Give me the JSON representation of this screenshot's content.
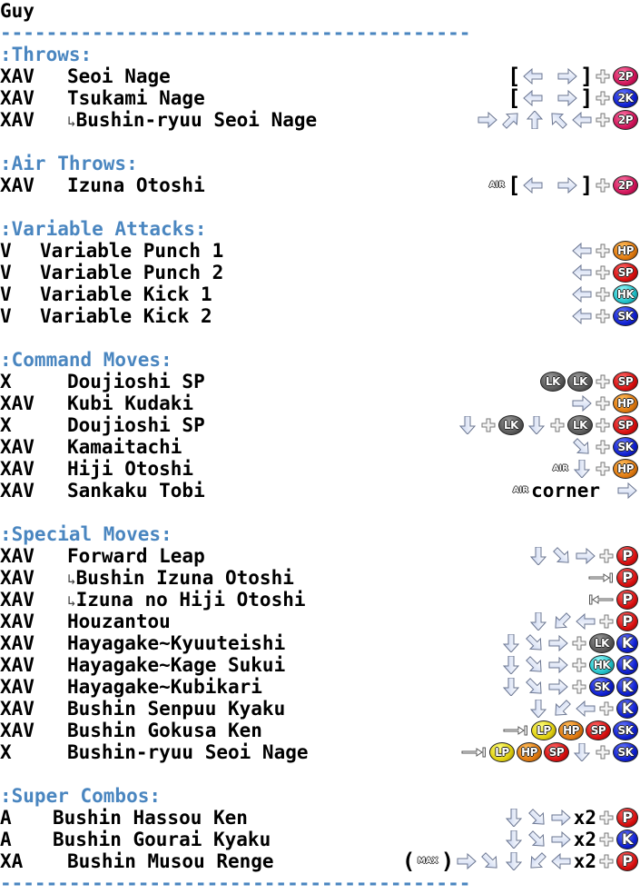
{
  "character": "Guy",
  "separator": "-----------------------------------------",
  "sections": {
    "throws": {
      "title": ":Throws:",
      "moves": [
        {
          "versions": "XAV",
          "name": "Seoi Nage",
          "input": "[ back/forward ] + 2P"
        },
        {
          "versions": "XAV",
          "name": "Tsukami Nage",
          "input": "[ back/forward ] + 2K"
        },
        {
          "versions": "XAV",
          "name": "Bushin-ryuu Seoi Nage",
          "hook": "↳",
          "input": "forward, up-forward, up, up-back, back + 2P"
        }
      ]
    },
    "air_throws": {
      "title": ":Air Throws:",
      "moves": [
        {
          "versions": "XAV",
          "name": "Izuna Otoshi",
          "input": "AIR [ back/forward ] + 2P"
        }
      ]
    },
    "variable": {
      "title": ":Variable Attacks:",
      "moves": [
        {
          "versions": "V",
          "name": "Variable Punch 1",
          "input": "back + HP"
        },
        {
          "versions": "V",
          "name": "Variable Punch 2",
          "input": "back + SP"
        },
        {
          "versions": "V",
          "name": "Variable Kick 1",
          "input": "back + HK"
        },
        {
          "versions": "V",
          "name": "Variable Kick 2",
          "input": "back + SK"
        }
      ]
    },
    "command": {
      "title": ":Command Moves:",
      "moves": [
        {
          "versions": "X",
          "name": "Doujioshi SP",
          "input": "LK LK + SP"
        },
        {
          "versions": "XAV",
          "name": "Kubi Kudaki",
          "input": "forward + HP"
        },
        {
          "versions": "X",
          "name": "Doujioshi SP",
          "input": "down + LK down + LK + SP"
        },
        {
          "versions": "XAV",
          "name": "Kamaitachi",
          "input": "down-forward + SK"
        },
        {
          "versions": "XAV",
          "name": "Hiji Otoshi",
          "input": "AIR down + HP"
        },
        {
          "versions": "XAV",
          "name": "Sankaku Tobi",
          "input": "AIR corner forward",
          "corner_text": "corner"
        }
      ]
    },
    "special": {
      "title": ":Special Moves:",
      "moves": [
        {
          "versions": "XAV",
          "name": "Forward Leap",
          "input": "down, down-forward, forward + P"
        },
        {
          "versions": "XAV",
          "name": "Bushin Izuna Otoshi",
          "hook": "↳",
          "input": "slide-forward P"
        },
        {
          "versions": "XAV",
          "name": "Izuna no Hiji Otoshi",
          "hook": "↳",
          "input": "slide-back P"
        },
        {
          "versions": "XAV",
          "name": "Houzantou",
          "input": "down, down-back, back + P"
        },
        {
          "versions": "XAV",
          "name": "Hayagake~Kyuuteishi",
          "input": "down, down-forward, forward + LK K"
        },
        {
          "versions": "XAV",
          "name": "Hayagake~Kage Sukui",
          "input": "down, down-forward, forward + HK K"
        },
        {
          "versions": "XAV",
          "name": "Hayagake~Kubikari",
          "input": "down, down-forward, forward + SK K"
        },
        {
          "versions": "XAV",
          "name": "Bushin Senpuu Kyaku",
          "input": "down, down-back, back + K"
        },
        {
          "versions": "XAV",
          "name": "Bushin Gokusa Ken",
          "input": "slide LP HP SP SK"
        },
        {
          "versions": "X",
          "name": "Bushin-ryuu Seoi Nage",
          "input": "slide LP HP SP down + SK"
        }
      ]
    },
    "super": {
      "title": ":Super Combos:",
      "moves": [
        {
          "versions": "A",
          "name": "Bushin Hassou Ken",
          "input": "down, down-forward, forward x2 + P"
        },
        {
          "versions": "A",
          "name": "Bushin Gourai Kyaku",
          "input": "down, down-forward, forward x2 + K"
        },
        {
          "versions": "XA",
          "name": "Bushin Musou Renge",
          "input": "(MAX) forward, down-forward, down, down-back, back x2 + P"
        }
      ]
    }
  },
  "labels": {
    "air": "AIR",
    "max": "MAX",
    "x2": "x2",
    "corner": "corner",
    "open_bracket": "[",
    "close_bracket": "]",
    "open_paren": "(",
    "close_paren": ")"
  },
  "buttons": {
    "2P": {
      "label": "2P",
      "color": "#d0155a"
    },
    "2K": {
      "label": "2K",
      "color": "#1020d0"
    },
    "HP": {
      "label": "HP",
      "color": "#e07a10"
    },
    "SP": {
      "label": "SP",
      "color": "#d81010"
    },
    "HK": {
      "label": "HK",
      "color": "#20c0c8"
    },
    "SK": {
      "label": "SK",
      "color": "#1020d0"
    },
    "LK": {
      "label": "LK",
      "color": "#5a5a5a"
    },
    "LP": {
      "label": "LP",
      "color": "#e0d010"
    },
    "P": {
      "label": "P",
      "color": "#d81010"
    },
    "K": {
      "label": "K",
      "color": "#1020d0"
    }
  },
  "colors": {
    "section_header": "#4a86c0",
    "text": "#000000",
    "background": "#ffffff"
  }
}
